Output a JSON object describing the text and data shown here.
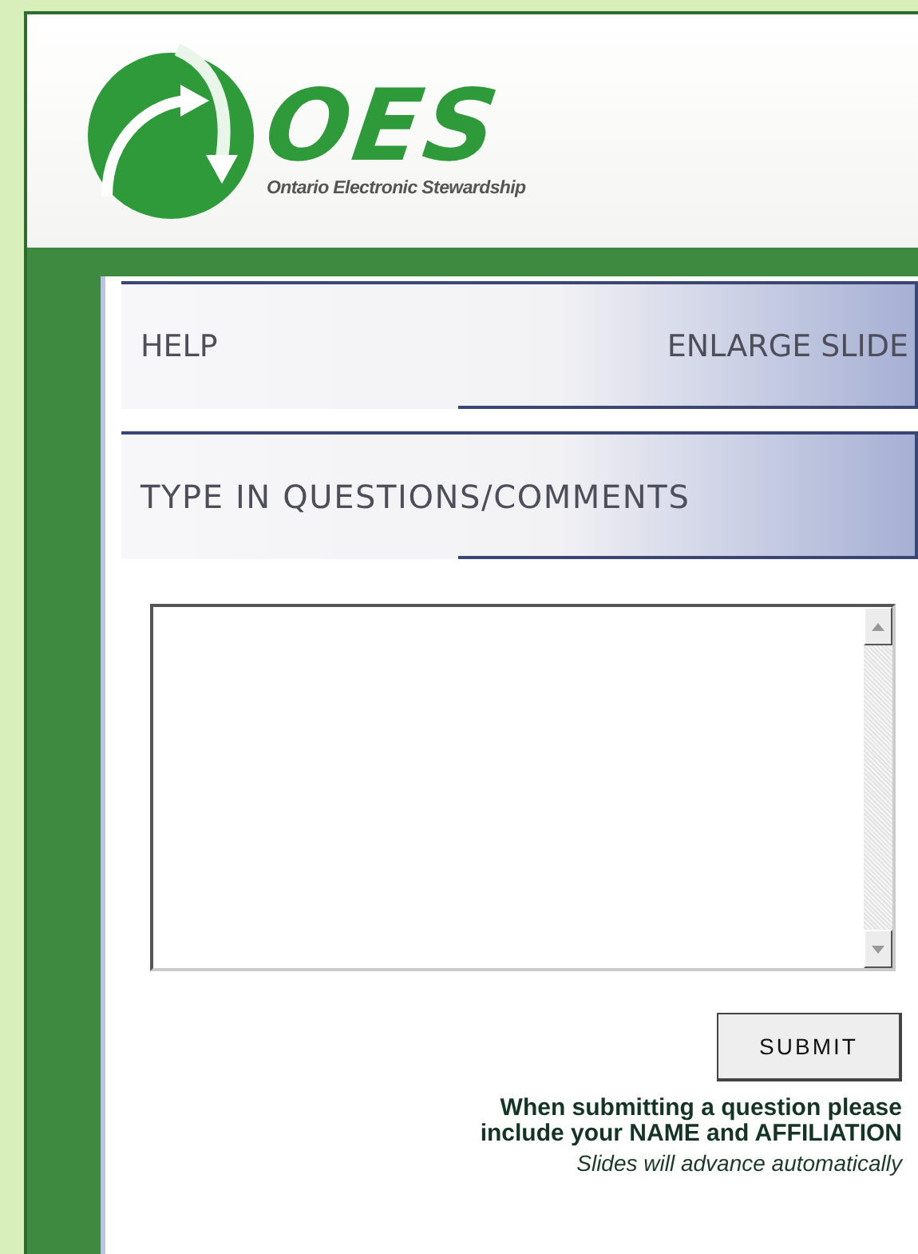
{
  "logo": {
    "name": "OES",
    "tagline": "Ontario Electronic Stewardship"
  },
  "toolbar": [
    {
      "label": "HELP"
    },
    {
      "label": "ENLARGE SLIDE"
    }
  ],
  "section_title": "TYPE IN QUESTIONS/COMMENTS",
  "submit_button": "SUBMIT",
  "notice": "When submitting a question please include your NAME and AFFILIATION",
  "footnote": "Slides will advance automatically"
}
